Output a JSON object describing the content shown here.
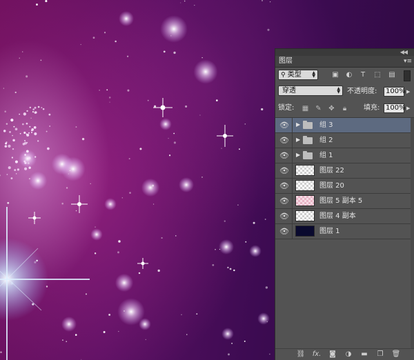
{
  "panel": {
    "collapse_icon": "double-chevron-icon",
    "tab_label": "图层",
    "menu_icon": "panel-menu-icon",
    "filter": {
      "kind_label": "类型",
      "icons": [
        "image-filter-icon",
        "adjustment-filter-icon",
        "type-filter-icon",
        "shape-filter-icon",
        "smart-object-filter-icon"
      ]
    },
    "blend_mode": "穿透",
    "opacity_label": "不透明度:",
    "opacity_value": "100%",
    "lock_label": "锁定:",
    "fill_label": "填充:",
    "fill_value": "100%",
    "layers": [
      {
        "name": "组 3",
        "type": "group",
        "selected": true
      },
      {
        "name": "组 2",
        "type": "group"
      },
      {
        "name": "组 1",
        "type": "group"
      },
      {
        "name": "图层 22",
        "type": "layer",
        "thumb": "transparent"
      },
      {
        "name": "图层 20",
        "type": "layer",
        "thumb": "transparent"
      },
      {
        "name": "图层 5 副本 5",
        "type": "layer",
        "thumb": "pink"
      },
      {
        "name": "图层 4 副本",
        "type": "layer",
        "thumb": "transparent"
      },
      {
        "name": "图层 1",
        "type": "layer",
        "thumb": "dark"
      }
    ],
    "bottom_icons": [
      "link-icon",
      "fx-icon",
      "mask-icon",
      "adjustment-icon",
      "folder-icon",
      "new-layer-icon",
      "trash-icon"
    ],
    "fx_text": "fx."
  }
}
